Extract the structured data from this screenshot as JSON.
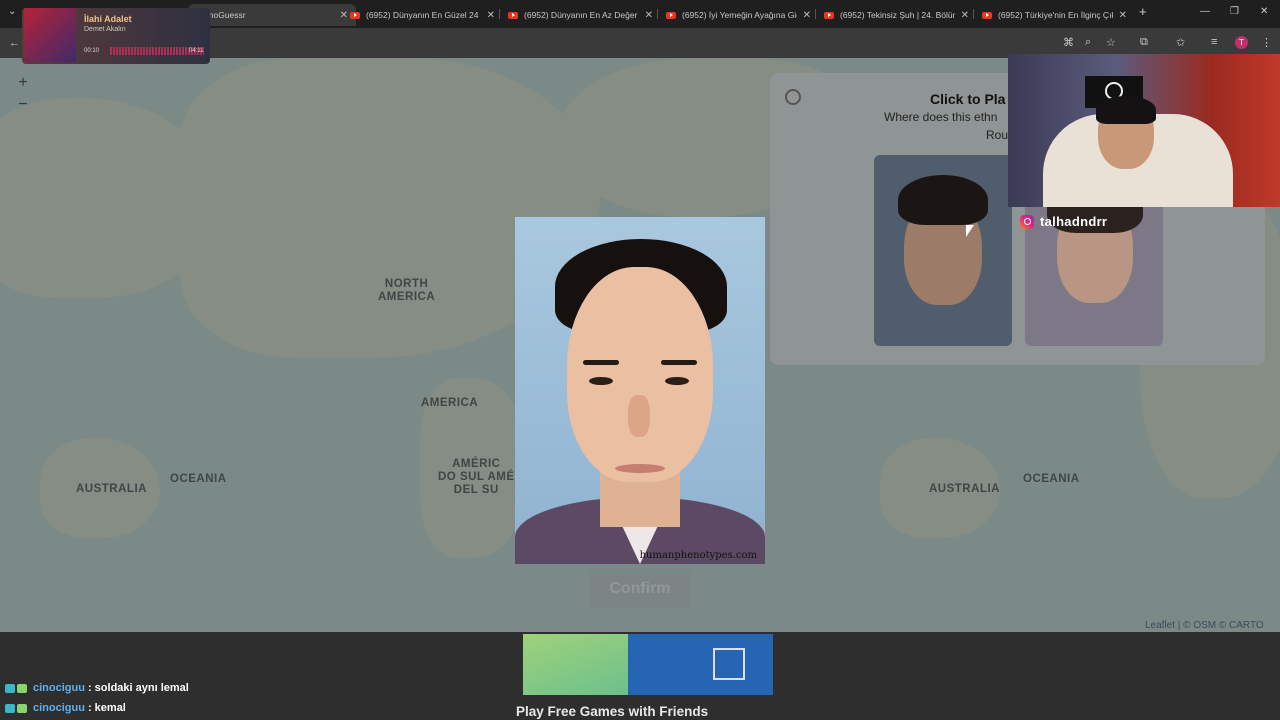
{
  "browser": {
    "tabs": [
      {
        "title": "EthnoGuessr",
        "active": true
      },
      {
        "title": "(6952) Dünyanın En Güzel 24 Y"
      },
      {
        "title": "(6952) Dünyanın En Az Değer V"
      },
      {
        "title": "(6952) İyi Yemeğin Ayağına Gid"
      },
      {
        "title": "(6952) Tekinsiz Şuh | 24. Bölüm"
      },
      {
        "title": "(6952) Türkiye'nin En İlginç Çık"
      }
    ],
    "new_tab_label": "+",
    "profile_initial": "T"
  },
  "music": {
    "title": "İlahi Adalet",
    "artist": "Demet Akalın",
    "current_time": "00:10",
    "duration": "04:11"
  },
  "map": {
    "zoom_in": "+",
    "zoom_out": "−",
    "labels": {
      "north_america": "NORTH\nAMERICA",
      "america": "AMERICA",
      "south_america": "AMÉRIC\nDO SUL AMÉ\nDEL SU",
      "australia_left": "AUSTRALIA",
      "oceania_left": "OCEANIA",
      "australia_right": "AUSTRALIA",
      "oceania_right": "OCEANIA"
    },
    "attribution": "Leaflet | © OSM © CARTO"
  },
  "game": {
    "title": "Click to Pla",
    "subtitle": "Where does this ethn",
    "round": "Rou",
    "modal_watermark": "humanphenotypes.com",
    "confirm_label": "Confirm"
  },
  "stream": {
    "instagram_handle": "talhadndrr"
  },
  "ad": {
    "title": "Play Free Games with Friends"
  },
  "chat": [
    {
      "user": "cinociguu",
      "message": ": soldaki aynı lemal"
    },
    {
      "user": "cinociguu",
      "message": ": kemal"
    }
  ]
}
